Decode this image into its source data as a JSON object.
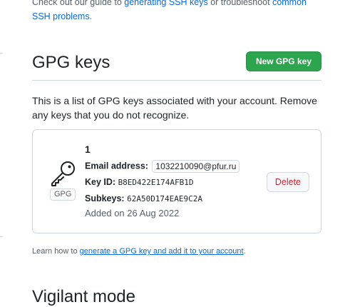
{
  "top_note": {
    "text_before": "Check out our guide to",
    "link1": "generating SSH keys",
    "text_mid": "or troubleshoot",
    "link2": "common SSH problems",
    "text_after": "."
  },
  "gpg_section": {
    "title": "GPG keys",
    "new_button_label": "New GPG key",
    "intro_text": "This is a list of GPG keys associated with your account. Remove any keys that you do not recognize."
  },
  "key_entry": {
    "name": "1",
    "badge": "GPG",
    "email_label": "Email address:",
    "email_value": "1032210090@pfur.ru",
    "key_id_label": "Key ID:",
    "key_id_value": "B8ED422E174AFB1D",
    "subkeys_label": "Subkeys:",
    "subkeys_value": "62A50D174EAE9C2A",
    "added_text": "Added on 26 Aug 2022",
    "delete_label": "Delete",
    "icon": "key-icon"
  },
  "learn_more": {
    "prefix": "Learn how to",
    "link": "generate a GPG key and add it to your account",
    "suffix": "."
  },
  "next_section": {
    "title": "Vigilant mode"
  },
  "colors": {
    "primary_button": "#2da44e",
    "link": "#0969da",
    "danger": "#cf222e",
    "border": "#d0d7de",
    "muted_text": "#57606a"
  }
}
